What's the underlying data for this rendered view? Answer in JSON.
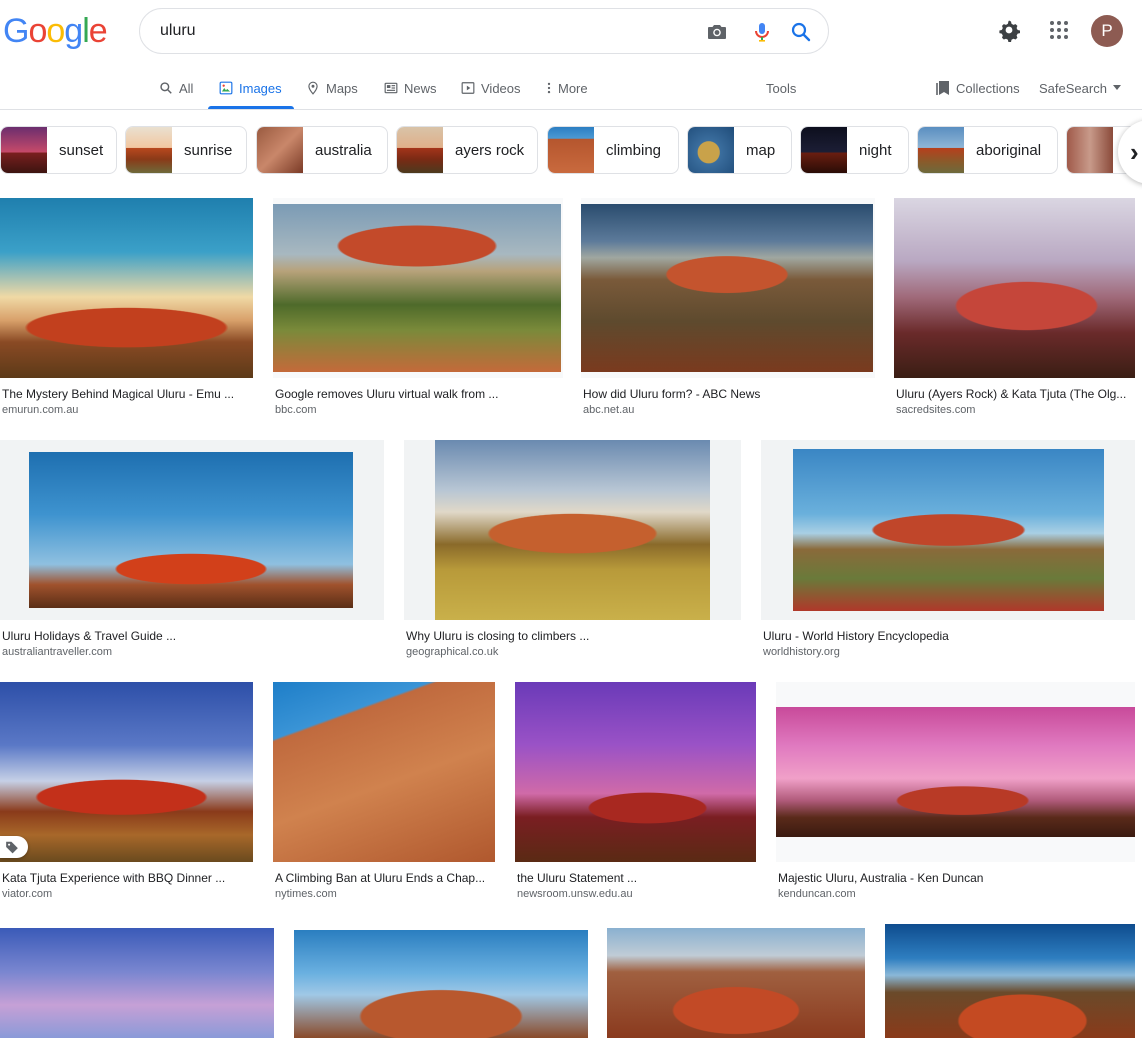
{
  "header": {
    "logo_letters": [
      {
        "ch": "G",
        "color": "#4285F4"
      },
      {
        "ch": "o",
        "color": "#EA4335"
      },
      {
        "ch": "o",
        "color": "#FBBC05"
      },
      {
        "ch": "g",
        "color": "#4285F4"
      },
      {
        "ch": "l",
        "color": "#34A853"
      },
      {
        "ch": "e",
        "color": "#EA4335"
      }
    ],
    "search_value": "uluru",
    "avatar_letter": "P",
    "icons": [
      "camera-icon",
      "microphone-icon",
      "search-icon",
      "gear-icon",
      "apps-grid-icon"
    ]
  },
  "tabs": [
    {
      "label": "All",
      "icon": "search-icon",
      "active": false
    },
    {
      "label": "Images",
      "icon": "image-icon",
      "active": true
    },
    {
      "label": "Maps",
      "icon": "map-pin-icon",
      "active": false
    },
    {
      "label": "News",
      "icon": "newspaper-icon",
      "active": false
    },
    {
      "label": "Videos",
      "icon": "play-icon",
      "active": false
    },
    {
      "label": "More",
      "icon": "more-vert-icon",
      "active": false
    },
    {
      "label": "Tools",
      "icon": "",
      "active": false
    }
  ],
  "right_tools": {
    "collections": "Collections",
    "safesearch": "SafeSearch"
  },
  "chips": [
    "sunset",
    "sunrise",
    "australia",
    "ayers rock",
    "climbing",
    "map",
    "night",
    "aboriginal",
    ""
  ],
  "results": [
    {
      "title": "The Mystery Behind Magical Uluru - Emu ...",
      "source": "emurun.com.au"
    },
    {
      "title": "Google removes Uluru virtual walk from ...",
      "source": "bbc.com"
    },
    {
      "title": "How did Uluru form? - ABC News",
      "source": "abc.net.au"
    },
    {
      "title": "Uluru (Ayers Rock) & Kata Tjuta (The Olg...",
      "source": "sacredsites.com"
    },
    {
      "title": "Uluru Holidays & Travel Guide ...",
      "source": "australiantraveller.com"
    },
    {
      "title": "Why Uluru is closing to climbers ...",
      "source": "geographical.co.uk"
    },
    {
      "title": "Uluru - World History Encyclopedia",
      "source": "worldhistory.org"
    },
    {
      "title": "Kata Tjuta Experience with BBQ Dinner ...",
      "source": "viator.com"
    },
    {
      "title": "A Climbing Ban at Uluru Ends a Chap...",
      "source": "nytimes.com"
    },
    {
      "title": "the Uluru Statement ...",
      "source": "newsroom.unsw.edu.au"
    },
    {
      "title": "Majestic Uluru, Australia - Ken Duncan",
      "source": "kenduncan.com"
    },
    {
      "title": "",
      "source": ""
    },
    {
      "title": "",
      "source": ""
    },
    {
      "title": "",
      "source": ""
    },
    {
      "title": "",
      "source": ""
    }
  ],
  "colors": {
    "accent": "#1a73e8",
    "rock": "#c2401e",
    "text_secondary": "#5f6368",
    "border": "#dfe1e5"
  }
}
